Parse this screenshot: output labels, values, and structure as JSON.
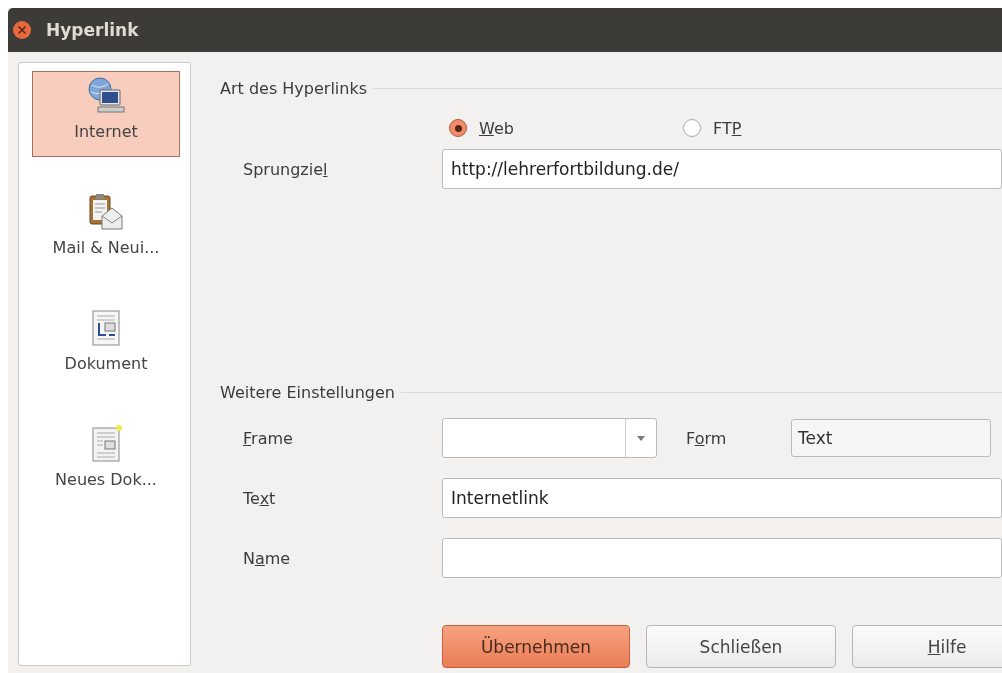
{
  "window": {
    "title": "Hyperlink"
  },
  "sidebar": {
    "items": [
      {
        "kind": "internet",
        "label": "Internet",
        "selected": true
      },
      {
        "kind": "mail",
        "label": "Mail & Neui...",
        "selected": false
      },
      {
        "kind": "document",
        "label": "Dokument",
        "selected": false
      },
      {
        "kind": "new_document",
        "label": "Neues Dok...",
        "selected": false
      }
    ]
  },
  "link_type": {
    "title": "Art des Hyperlinks",
    "options": [
      {
        "label": {
          "key": "W",
          "post": "eb"
        },
        "selected": true
      },
      {
        "label": {
          "pre": "FT",
          "key": "P"
        },
        "selected": false
      }
    ],
    "target": {
      "label": {
        "pre": "Sprungzie",
        "key": "l"
      },
      "value": "http://lehrerfortbildung.de/"
    }
  },
  "further_settings": {
    "title": "Weitere Einstellungen",
    "frame": {
      "label": {
        "key": "F",
        "post": "rame"
      }
    },
    "form": {
      "label": {
        "pre": "F",
        "key": "o",
        "post": "rm"
      },
      "value": "Text"
    },
    "text": {
      "label": {
        "pre": "Te",
        "key": "x",
        "post": "t"
      },
      "value": "Internetlink"
    },
    "name": {
      "label": {
        "pre": "N",
        "key": "a",
        "post": "me"
      }
    }
  },
  "buttons": [
    {
      "label": {
        "pre": "Übernehmen"
      },
      "default": true
    },
    {
      "label": {
        "pre": "Schließen"
      },
      "default": false
    },
    {
      "label": {
        "key": "H",
        "post": "ilfe"
      },
      "default": false
    }
  ]
}
